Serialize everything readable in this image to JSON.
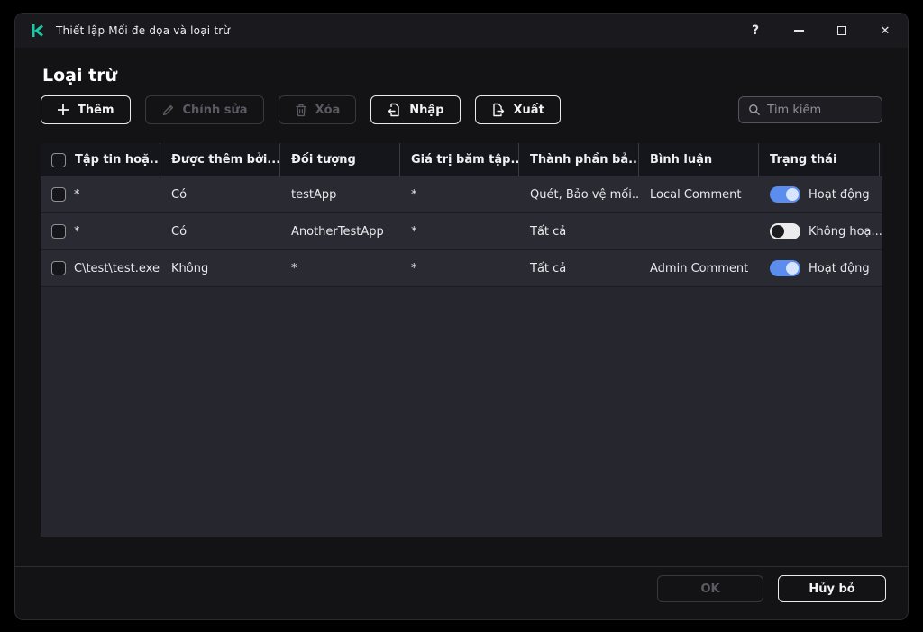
{
  "window": {
    "title": "Thiết lập Mối đe dọa và loại trừ",
    "controls": {
      "help": "?",
      "close": "✕"
    }
  },
  "page": {
    "heading": "Loại trừ"
  },
  "toolbar": {
    "add": "Thêm",
    "edit": "Chỉnh sửa",
    "delete": "Xóa",
    "import": "Nhập",
    "export": "Xuất",
    "search_placeholder": "Tìm kiếm"
  },
  "table": {
    "headers": [
      "Tập tin hoặ...",
      "Được thêm bởi...",
      "Đối tượng",
      "Giá trị băm tập...",
      "Thành phần bả...",
      "Bình luận",
      "Trạng thái"
    ],
    "rows": [
      {
        "file": "*",
        "added_by": "Có",
        "object": "testApp",
        "hash": "*",
        "component": "Quét, Bảo vệ mối...",
        "comment": "Local Comment",
        "status": "Hoạt động",
        "enabled": true
      },
      {
        "file": "*",
        "added_by": "Có",
        "object": "AnotherTestApp",
        "hash": "*",
        "component": "Tất cả",
        "comment": "",
        "status": "Không hoạ...",
        "enabled": false
      },
      {
        "file": "C\\test\\test.exe",
        "added_by": "Không",
        "object": "*",
        "hash": "*",
        "component": "Tất cả",
        "comment": "Admin Comment",
        "status": "Hoạt động",
        "enabled": true
      }
    ]
  },
  "footer": {
    "ok": "OK",
    "cancel": "Hủy bỏ"
  },
  "colors": {
    "logo": "#1dc6a4",
    "toggle_on": "#5b8def",
    "window_bg": "#131316",
    "row_bg": "#2a2a33"
  }
}
